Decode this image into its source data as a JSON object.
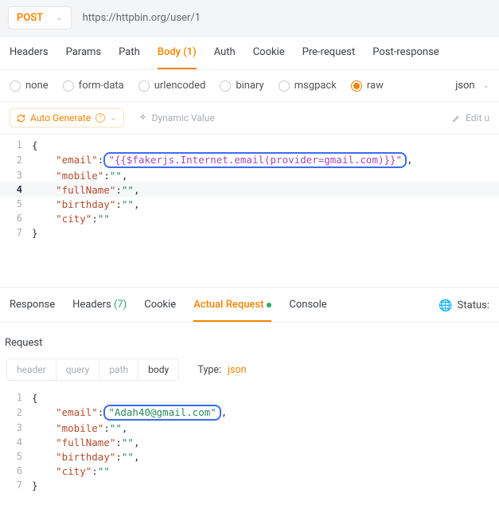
{
  "topbar": {
    "method": "POST",
    "url": "https://httpbin.org/user/1"
  },
  "tabs": {
    "headers": "Headers",
    "params": "Params",
    "path": "Path",
    "body": "Body",
    "body_count": "(1)",
    "auth": "Auth",
    "cookie": "Cookie",
    "pre_request": "Pre-request",
    "post_response": "Post-response"
  },
  "body_types": {
    "none": "none",
    "form": "form-data",
    "urlencoded": "urlencoded",
    "binary": "binary",
    "msgpack": "msgpack",
    "raw": "raw",
    "lang": "json"
  },
  "toolbar": {
    "auto_generate": "Auto Generate",
    "help": "?",
    "dynamic_value": "Dynamic Value",
    "edit": "Edit u"
  },
  "editor_top": {
    "l1": "{",
    "l2_key": "\"email\"",
    "l2_val": "\"{{$fakerjs.Internet.email(provider=gmail.com)}}\"",
    "l3_key": "\"mobile\"",
    "l3_val": "\"\"",
    "l4_key": "\"fullName\"",
    "l4_val": "\"\"",
    "l5_key": "\"birthday\"",
    "l5_val": "\"\"",
    "l6_key": "\"city\"",
    "l6_val": "\"\"",
    "l7": "}"
  },
  "resp_tabs": {
    "response": "Response",
    "headers": "Headers",
    "headers_count": "(7)",
    "cookie": "Cookie",
    "actual": "Actual Request",
    "console": "Console",
    "status": "Status:"
  },
  "request_section": {
    "title": "Request"
  },
  "sub_tabs": {
    "header": "header",
    "query": "query",
    "path": "path",
    "body": "body"
  },
  "type_row": {
    "label": "Type:",
    "value": "json"
  },
  "editor_bottom": {
    "l1": "{",
    "l2_key": "\"email\"",
    "l2_val": "\"Adah40@gmail.com\"",
    "l3_key": "\"mobile\"",
    "l3_val": "\"\"",
    "l4_key": "\"fullName\"",
    "l4_val": "\"\"",
    "l5_key": "\"birthday\"",
    "l5_val": "\"\"",
    "l6_key": "\"city\"",
    "l6_val": "\"\"",
    "l7": "}"
  }
}
